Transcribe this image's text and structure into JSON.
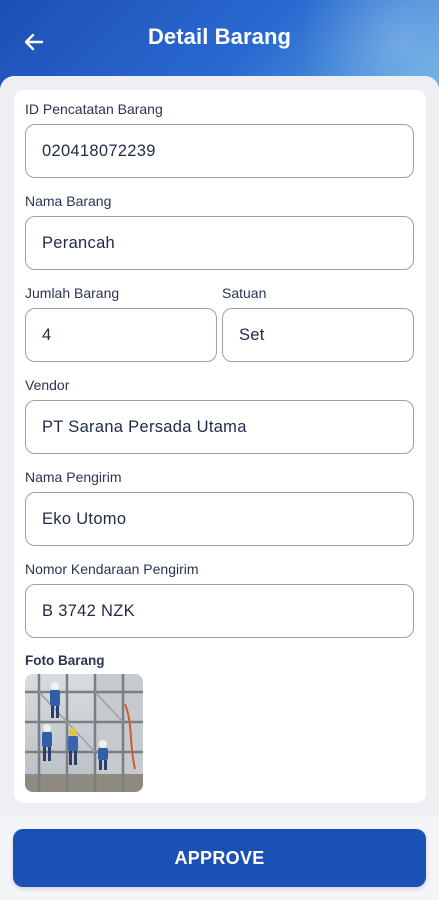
{
  "header": {
    "title": "Detail Barang",
    "back_icon": "arrow-left-icon"
  },
  "form": {
    "id_pencatatan": {
      "label": "ID Pencatatan Barang",
      "value": "020418072239"
    },
    "nama_barang": {
      "label": "Nama Barang",
      "value": "Perancah"
    },
    "jumlah_barang": {
      "label": "Jumlah Barang",
      "value": "4"
    },
    "satuan": {
      "label": "Satuan",
      "value": "Set"
    },
    "vendor": {
      "label": "Vendor",
      "value": "PT Sarana Persada Utama"
    },
    "nama_pengirim": {
      "label": "Nama Pengirim",
      "value": "Eko Utomo"
    },
    "nomor_kendaraan": {
      "label": "Nomor Kendaraan Pengirim",
      "value": "B 3742 NZK"
    },
    "foto_barang": {
      "label": "Foto Barang"
    }
  },
  "footer": {
    "approve_label": "APPROVE"
  },
  "colors": {
    "header_gradient_start": "#1d4fb8",
    "header_gradient_end": "#6fb3e6",
    "primary_button": "#1b50b6"
  }
}
